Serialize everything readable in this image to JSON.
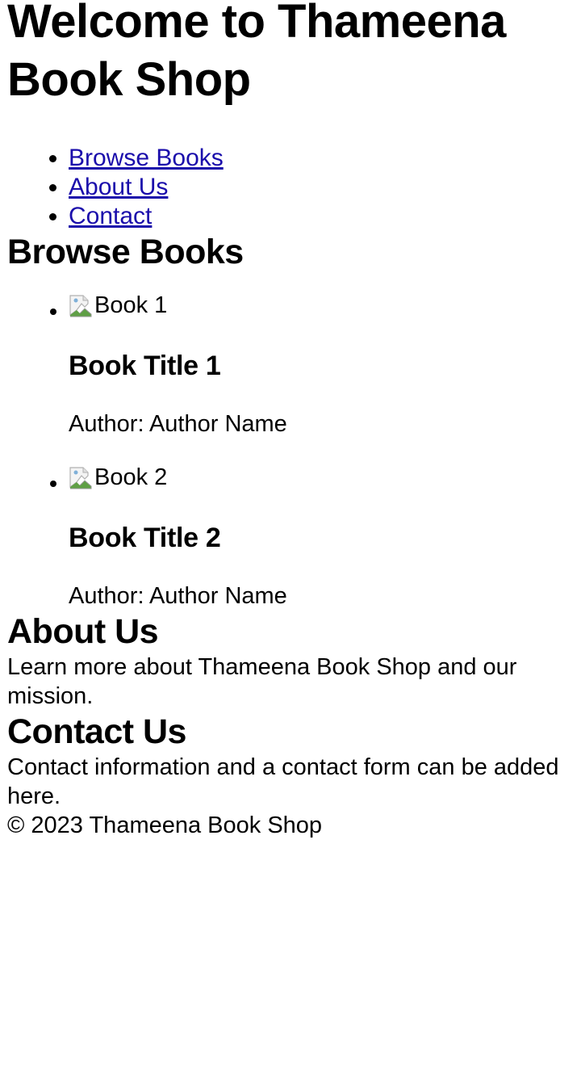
{
  "header": {
    "title": "Welcome to Thameena Book Shop"
  },
  "nav": {
    "items": [
      {
        "label": "Browse Books"
      },
      {
        "label": "About Us"
      },
      {
        "label": "Contact"
      }
    ]
  },
  "browse": {
    "heading": "Browse Books",
    "books": [
      {
        "img_alt": "Book 1",
        "title": "Book Title 1",
        "author": "Author: Author Name"
      },
      {
        "img_alt": "Book 2",
        "title": "Book Title 2",
        "author": "Author: Author Name"
      }
    ]
  },
  "about": {
    "heading": "About Us",
    "text": "Learn more about Thameena Book Shop and our mission."
  },
  "contact": {
    "heading": "Contact Us",
    "text": "Contact information and a contact form can be added here."
  },
  "footer": {
    "text": "© 2023 Thameena Book Shop"
  },
  "icons": {
    "book_image": "broken-image-icon"
  }
}
